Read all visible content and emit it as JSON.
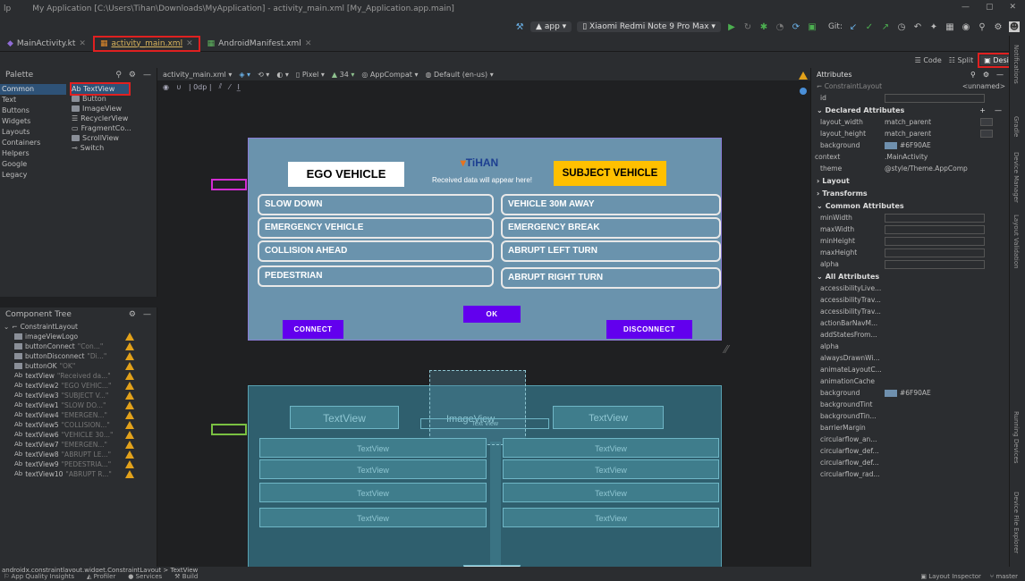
{
  "window": {
    "menu_fragment": "lp",
    "title": "My Application [C:\\Users\\Tihan\\Downloads\\MyApplication] - activity_main.xml [My_Application.app.main]"
  },
  "toolbar": {
    "run_config": "app",
    "device": "Xiaomi Redmi Note 9 Pro Max",
    "git_label": "Git:"
  },
  "tabs": [
    {
      "label": "MainActivity.kt"
    },
    {
      "label": "activity_main.xml"
    },
    {
      "label": "AndroidManifest.xml"
    }
  ],
  "modes": {
    "code": "Code",
    "split": "Split",
    "design": "Design"
  },
  "palette": {
    "title": "Palette",
    "categories": [
      "Common",
      "Text",
      "Buttons",
      "Widgets",
      "Layouts",
      "Containers",
      "Helpers",
      "Google",
      "Legacy"
    ],
    "items": [
      "Ab TextView",
      "Button",
      "ImageView",
      "RecyclerView",
      "FragmentCo...",
      "ScrollView",
      "Switch"
    ]
  },
  "design_toolbar": {
    "file": "activity_main.xml",
    "device": "Pixel",
    "api": "34",
    "theme": "AppCompat",
    "locale": "Default (en-us)",
    "margin": "0dp"
  },
  "component_tree": {
    "title": "Component Tree",
    "root": "ConstraintLayout",
    "items": [
      {
        "icon": "image",
        "name": "imageViewLogo",
        "hint": ""
      },
      {
        "icon": "button",
        "name": "buttonConnect",
        "hint": "\"Con...\""
      },
      {
        "icon": "button",
        "name": "buttonDisconnect",
        "hint": "\"Di...\""
      },
      {
        "icon": "button",
        "name": "buttonOK",
        "hint": "\"OK\""
      },
      {
        "icon": "text",
        "name": "textView",
        "hint": "\"Received da...\""
      },
      {
        "icon": "text",
        "name": "textView2",
        "hint": "\"EGO VEHIC...\""
      },
      {
        "icon": "text",
        "name": "textView3",
        "hint": "\"SUBJECT V...\""
      },
      {
        "icon": "text",
        "name": "textView1",
        "hint": "\"SLOW DO...\""
      },
      {
        "icon": "text",
        "name": "textView4",
        "hint": "\"EMERGEN...\""
      },
      {
        "icon": "text",
        "name": "textView5",
        "hint": "\"COLLISION...\""
      },
      {
        "icon": "text",
        "name": "textView6",
        "hint": "\"VEHICLE 30...\""
      },
      {
        "icon": "text",
        "name": "textView7",
        "hint": "\"EMERGEN...\""
      },
      {
        "icon": "text",
        "name": "textView8",
        "hint": "\"ABRUPT LE...\""
      },
      {
        "icon": "text",
        "name": "textView9",
        "hint": "\"PEDESTRIA...\""
      },
      {
        "icon": "text",
        "name": "textView10",
        "hint": "\"ABRUPT R...\""
      }
    ]
  },
  "preview": {
    "ego_label": "EGO VEHICLE",
    "subject_label": "SUBJECT VEHICLE",
    "logo_text": "TiHAN",
    "received": "Received data will appear here!",
    "left_buttons": [
      "SLOW DOWN",
      "EMERGENCY VEHICLE",
      "COLLISION AHEAD",
      "PEDESTRIAN"
    ],
    "right_buttons": [
      "VEHICLE 30M AWAY",
      "EMERGENCY BREAK",
      "ABRUPT LEFT TURN",
      "ABRUPT RIGHT TURN"
    ],
    "ok": "OK",
    "connect": "CONNECT",
    "disconnect": "DISCONNECT"
  },
  "blueprint": {
    "textview": "TextView",
    "imageview": "ImageView",
    "small_text": "Text View"
  },
  "attributes": {
    "title": "Attributes",
    "layout_name": "ConstraintLayout",
    "unnamed": "<unnamed>",
    "id_label": "id",
    "declared": "Declared Attributes",
    "declared_rows": [
      {
        "name": "layout_width",
        "value": "match_parent"
      },
      {
        "name": "layout_height",
        "value": "match_parent"
      },
      {
        "name": "background",
        "value": "#6F90AE"
      },
      {
        "name": "context",
        "value": ".MainActivity"
      },
      {
        "name": "theme",
        "value": "@style/Theme.AppComp"
      }
    ],
    "layout": "Layout",
    "transforms": "Transforms",
    "common": "Common Attributes",
    "common_rows": [
      "minWidth",
      "maxWidth",
      "minHeight",
      "maxHeight",
      "alpha"
    ],
    "all": "All Attributes",
    "all_rows": [
      {
        "name": "accessibilityLive...",
        "value": ""
      },
      {
        "name": "accessibilityTrav...",
        "value": ""
      },
      {
        "name": "accessibilityTrav...",
        "value": ""
      },
      {
        "name": "actionBarNavM...",
        "value": ""
      },
      {
        "name": "addStatesFrom...",
        "value": ""
      },
      {
        "name": "alpha",
        "value": ""
      },
      {
        "name": "alwaysDrawnWi...",
        "value": ""
      },
      {
        "name": "animateLayoutC...",
        "value": ""
      },
      {
        "name": "animationCache",
        "value": ""
      },
      {
        "name": "background",
        "value": "#6F90AE"
      },
      {
        "name": "backgroundTint",
        "value": ""
      },
      {
        "name": "backgroundTin...",
        "value": ""
      },
      {
        "name": "barrierMargin",
        "value": ""
      },
      {
        "name": "circularflow_an...",
        "value": ""
      },
      {
        "name": "circularflow_def...",
        "value": ""
      },
      {
        "name": "circularflow_def...",
        "value": ""
      },
      {
        "name": "circularflow_rad...",
        "value": ""
      }
    ],
    "bg_color": "#6F90AE"
  },
  "side_tools": [
    "Notifications",
    "Gradle",
    "Device Manager",
    "Layout Validation",
    "Running Devices",
    "Device File Explorer"
  ],
  "breadcrumb": "androidx.constraintlayout.widget.ConstraintLayout  >  TextView",
  "status": {
    "items": [
      "App Quality Insights",
      "Profiler",
      "Services",
      "Build"
    ],
    "layout_inspector": "Layout Inspector",
    "branch": "master"
  }
}
